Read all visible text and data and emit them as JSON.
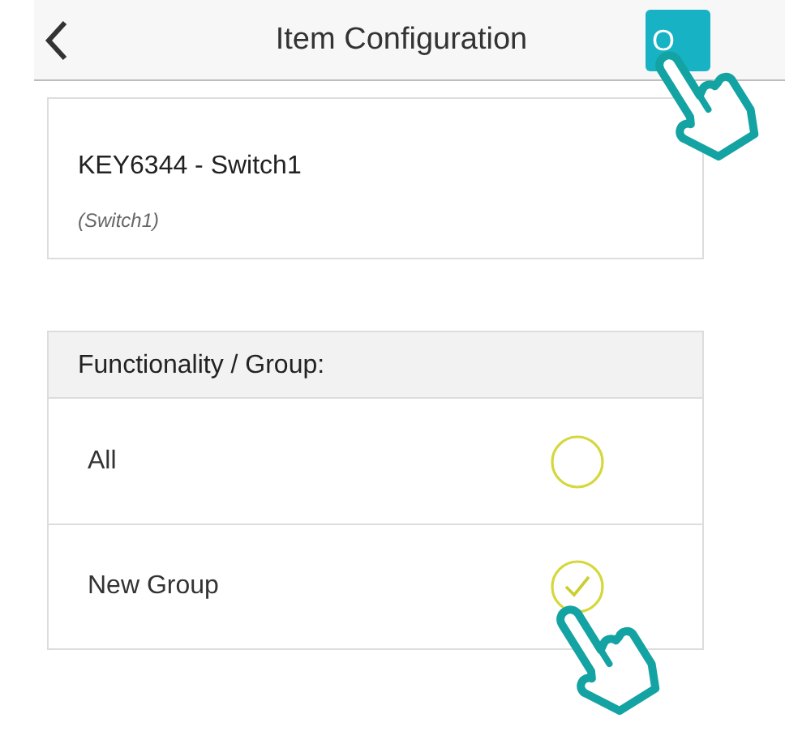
{
  "header": {
    "title": "Item Configuration",
    "ok_button": {
      "label": "O"
    }
  },
  "item": {
    "name": "KEY6344 - Switch1",
    "subtitle": "(Switch1)"
  },
  "group_section": {
    "heading": "Functionality / Group:",
    "options": [
      {
        "label": "All",
        "selected": false
      },
      {
        "label": "New Group",
        "selected": true
      }
    ]
  }
}
